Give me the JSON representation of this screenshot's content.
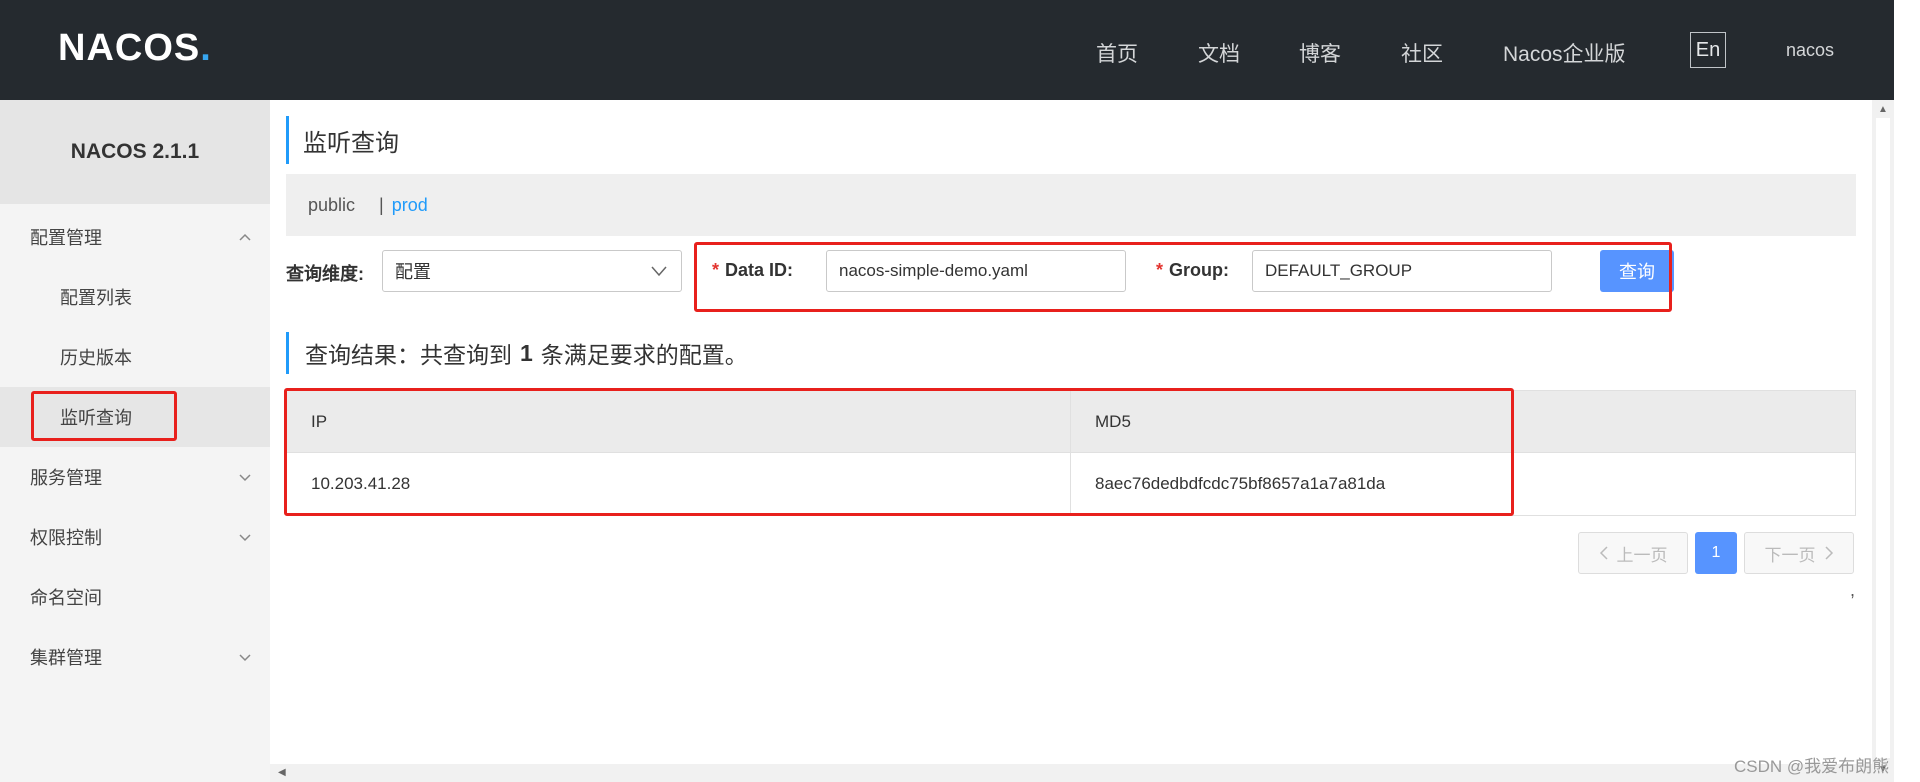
{
  "topbar": {
    "logo": "NACOS",
    "logo_dot": ".",
    "nav": [
      "首页",
      "文档",
      "博客",
      "社区",
      "Nacos企业版"
    ],
    "lang": "En",
    "user": "nacos"
  },
  "sidebar": {
    "version": "NACOS 2.1.1",
    "items": [
      {
        "label": "配置管理",
        "expanded": true
      },
      {
        "label": "配置列表"
      },
      {
        "label": "历史版本"
      },
      {
        "label": "监听查询",
        "active": true
      },
      {
        "label": "服务管理",
        "expanded": false
      },
      {
        "label": "权限控制",
        "expanded": false
      },
      {
        "label": "命名空间"
      },
      {
        "label": "集群管理",
        "expanded": false
      }
    ]
  },
  "main": {
    "title": "监听查询",
    "namespaces": {
      "public": "public",
      "separator": "|",
      "prod": "prod"
    },
    "form": {
      "dimension_label": "查询维度:",
      "dimension_value": "配置",
      "required_mark": "*",
      "dataid_label": "Data ID:",
      "dataid_value": "nacos-simple-demo.yaml",
      "group_label": "Group:",
      "group_value": "DEFAULT_GROUP",
      "query_button": "查询"
    },
    "result": {
      "prefix": "查询结果：共查询到",
      "count": "1",
      "suffix": "条满足要求的配置。"
    },
    "table": {
      "columns": [
        "IP",
        "MD5"
      ],
      "rows": [
        [
          "10.203.41.28",
          "8aec76dedbdfcdc75bf8657a1a7a81da"
        ]
      ]
    },
    "pager": {
      "prev": "上一页",
      "current": "1",
      "next": "下一页"
    },
    "stray_mark": ","
  },
  "watermark": "CSDN @我爱布朗熊",
  "colors": {
    "accent": "#209bfa",
    "primary_button": "#5794ff",
    "highlight_box": "#e8201c",
    "topbar": "#252a2f"
  }
}
